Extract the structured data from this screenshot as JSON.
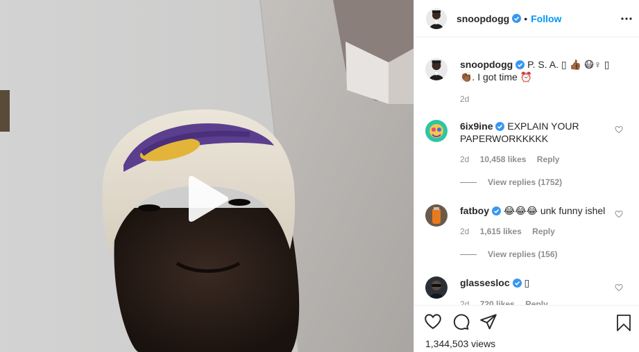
{
  "post": {
    "author": "snoopdogg",
    "follow_label": "Follow",
    "separator": "•",
    "caption": {
      "username": "snoopdogg",
      "text": "P. S. A. ▯ 👍🏾 😷♀ ▯ 👏🏾. I got time ⏰",
      "time": "2d"
    },
    "views": "1,344,503 views"
  },
  "comments": [
    {
      "username": "6ix9ine",
      "text": "EXPLAIN YOUR PAPERWORKKKKK",
      "time": "2d",
      "likes": "10,458 likes",
      "reply_label": "Reply",
      "view_replies": "View replies (1752)"
    },
    {
      "username": "fatboy",
      "text": "😂😂😂 unk funny ishel",
      "time": "2d",
      "likes": "1,615 likes",
      "reply_label": "Reply",
      "view_replies": "View replies (156)"
    },
    {
      "username": "glassesloc",
      "text": "▯",
      "time": "2d",
      "likes": "720 likes",
      "reply_label": "Reply"
    }
  ],
  "icons": {
    "play": "play-icon",
    "verified": "verified-badge-icon",
    "more": "more-options-icon",
    "like": "heart-icon",
    "comment": "comment-icon",
    "share": "share-icon",
    "save": "bookmark-icon"
  },
  "colors": {
    "link_blue": "#0095f6",
    "verified_blue": "#3897f0",
    "muted_text": "#8e8e8e",
    "divider": "#efefef"
  }
}
